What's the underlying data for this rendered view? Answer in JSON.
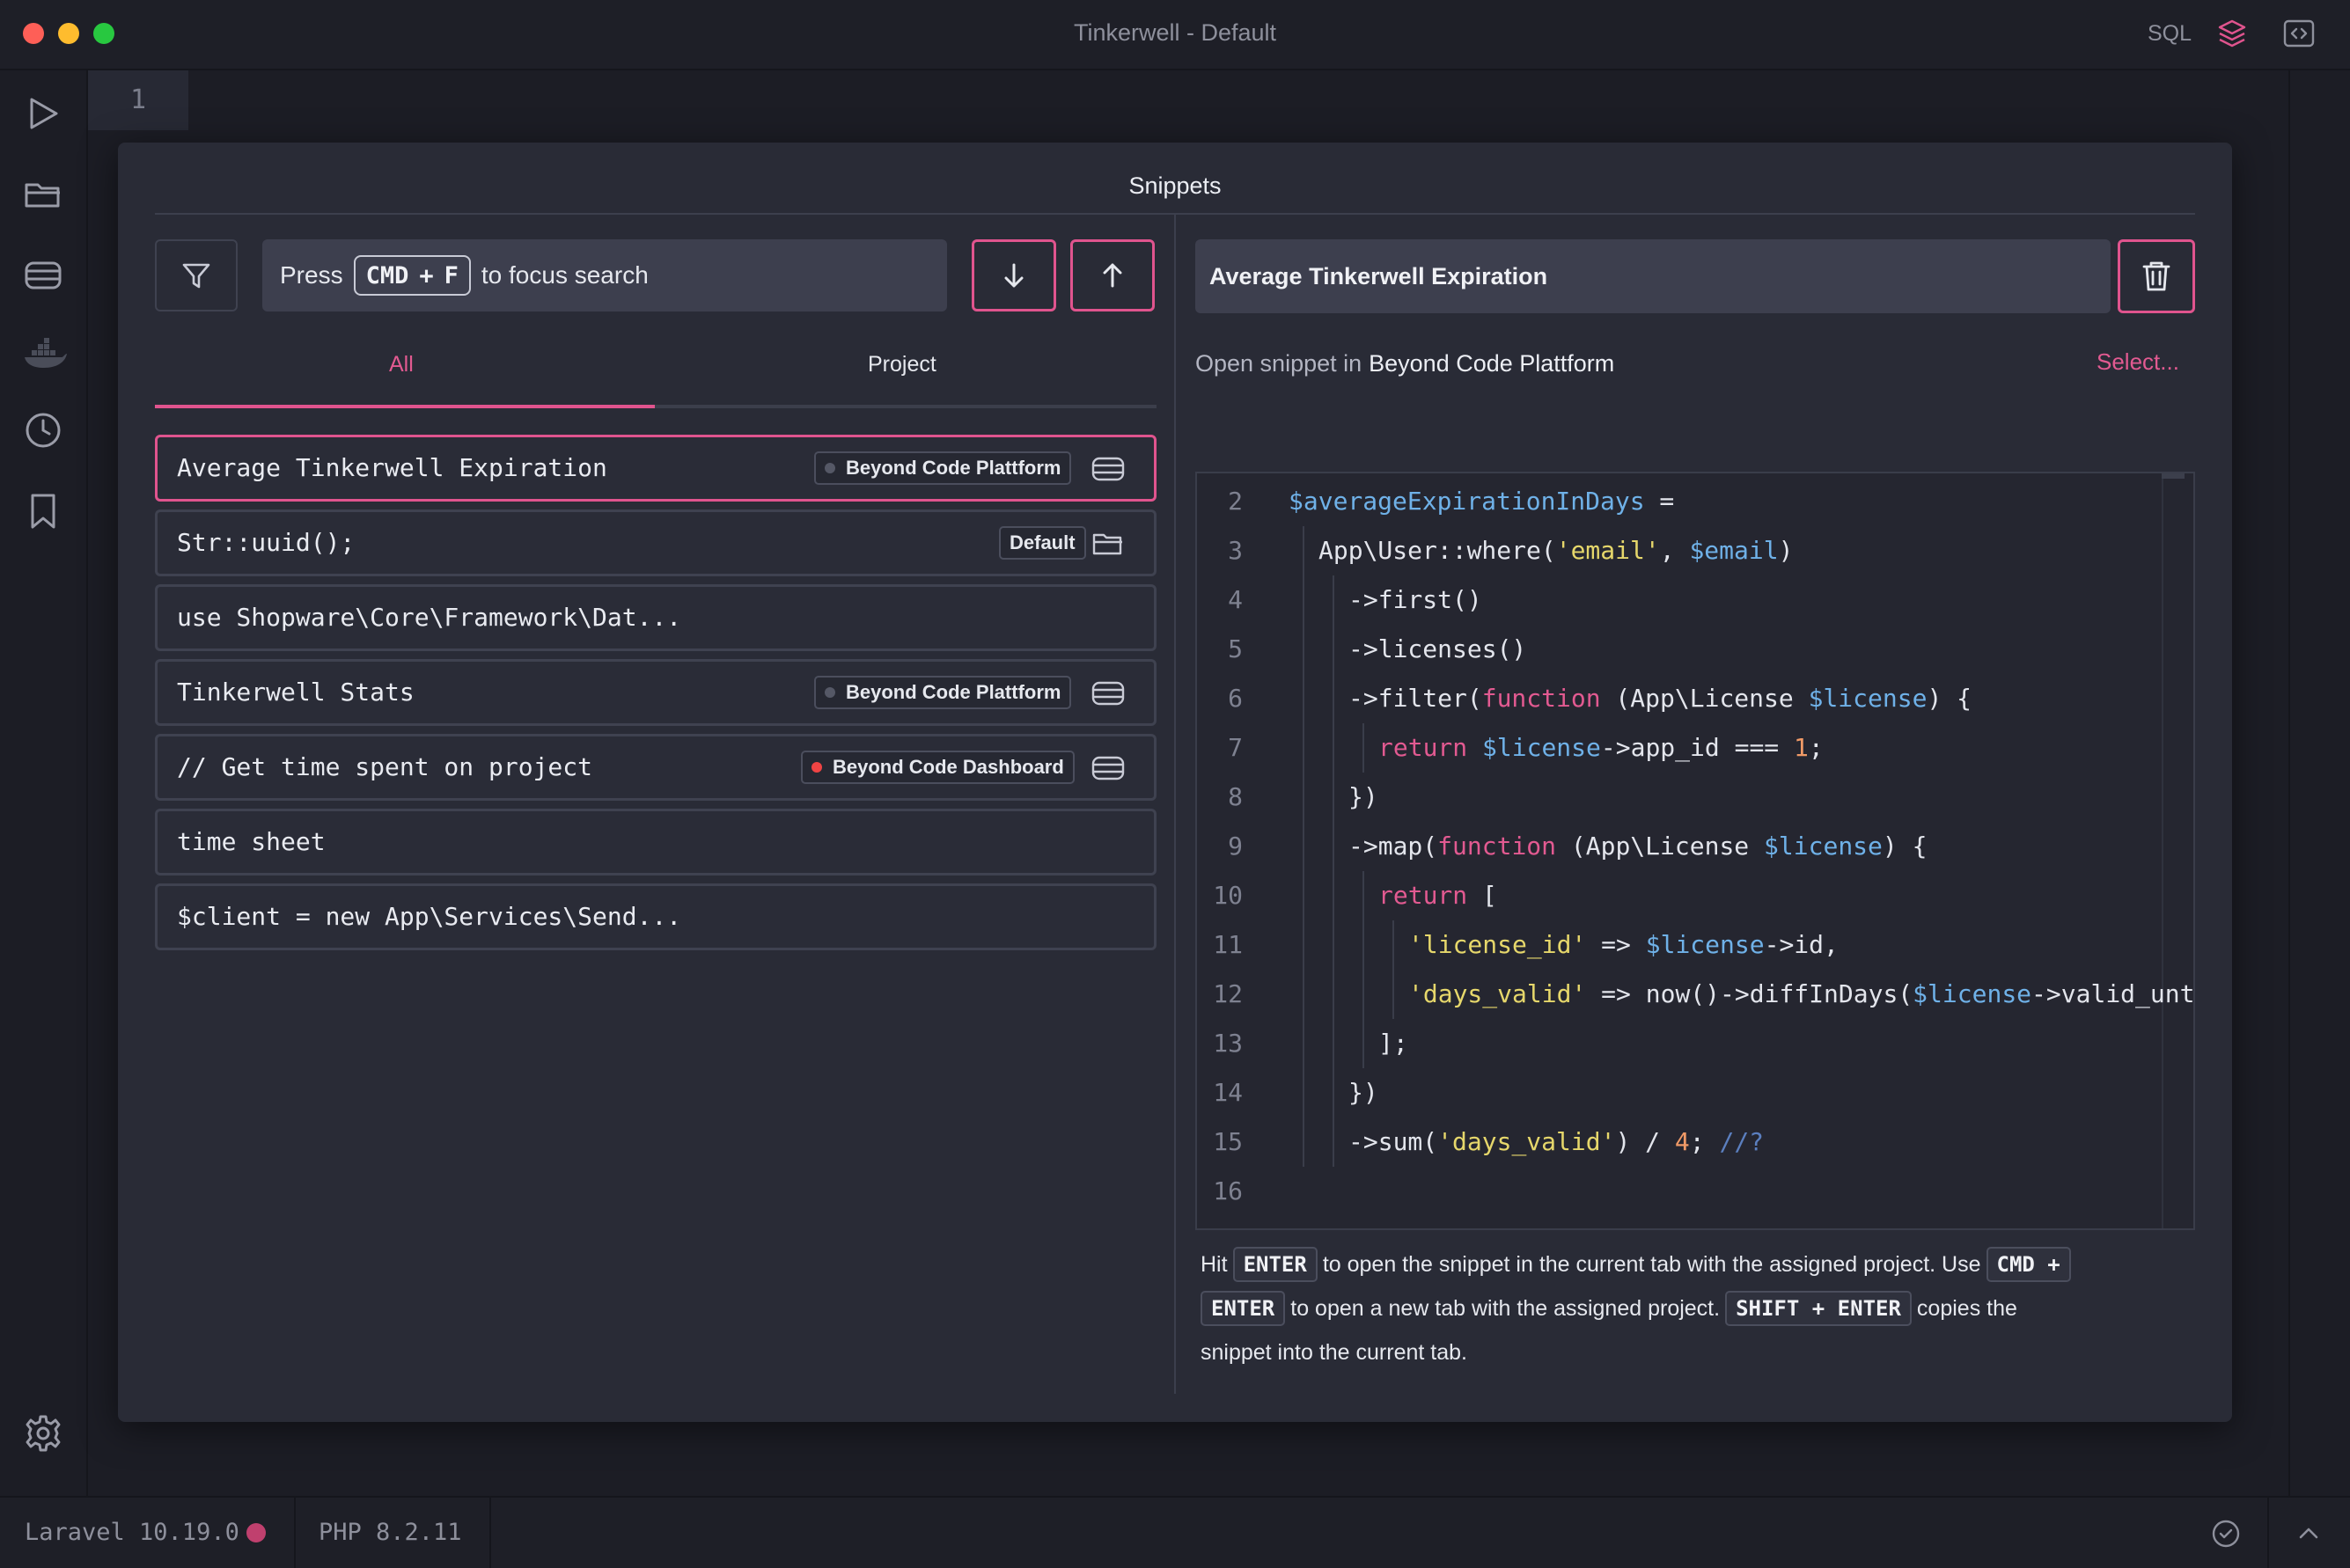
{
  "window": {
    "title": "Tinkerwell - Default",
    "sql_label": "SQL"
  },
  "sidebar": {
    "items": [
      {
        "name": "run",
        "icon": "play-icon"
      },
      {
        "name": "open",
        "icon": "folder-icon"
      },
      {
        "name": "servers",
        "icon": "server-icon"
      },
      {
        "name": "docker",
        "icon": "docker-icon"
      },
      {
        "name": "history",
        "icon": "clock-icon"
      },
      {
        "name": "snippets",
        "icon": "bookmark-icon"
      }
    ],
    "settings_icon": "gear-icon"
  },
  "editor": {
    "line_number": "1"
  },
  "modal": {
    "title": "Snippets",
    "search": {
      "press": "Press",
      "key1": "CMD",
      "plus": "+",
      "key2": "F",
      "suffix": "to focus search"
    },
    "tabs": [
      {
        "label": "All",
        "active": true
      },
      {
        "label": "Project",
        "active": false
      }
    ],
    "snippets": [
      {
        "text": "Average Tinkerwell Expiration",
        "badge": "Beyond Code Plattform",
        "dot": "#555866",
        "icon": "server-icon",
        "selected": true
      },
      {
        "text": "Str::uuid();",
        "badge": "Default",
        "dot": "",
        "icon": "folder-icon",
        "selected": false
      },
      {
        "text": "use Shopware\\Core\\Framework\\Dat...",
        "badge": "",
        "dot": "",
        "icon": "",
        "selected": false
      },
      {
        "text": "Tinkerwell Stats",
        "badge": "Beyond Code Plattform",
        "dot": "#555866",
        "icon": "server-icon",
        "selected": false
      },
      {
        "text": "// Get time spent on project",
        "badge": "Beyond Code Dashboard",
        "dot": "#ef4444",
        "icon": "server-icon",
        "selected": false
      },
      {
        "text": "time sheet",
        "badge": "",
        "dot": "",
        "icon": "",
        "selected": false
      },
      {
        "text": "$client = new App\\Services\\Send...",
        "badge": "",
        "dot": "",
        "icon": "",
        "selected": false
      }
    ],
    "detail": {
      "title": "Average Tinkerwell Expiration",
      "open_in_label": "Open snippet in",
      "open_in_project": "Beyond Code Plattform",
      "select_label": "Select..."
    },
    "code": [
      {
        "n": "2",
        "indent": 0,
        "tokens": [
          [
            "var",
            "$averageExpirationInDays"
          ],
          [
            "plain",
            " ="
          ]
        ]
      },
      {
        "n": "3",
        "indent": 1,
        "tokens": [
          [
            "plain",
            "App\\User::where("
          ],
          [
            "str",
            "'email'"
          ],
          [
            "plain",
            ", "
          ],
          [
            "var",
            "$email"
          ],
          [
            "plain",
            ")"
          ]
        ]
      },
      {
        "n": "4",
        "indent": 2,
        "tokens": [
          [
            "plain",
            "->first()"
          ]
        ]
      },
      {
        "n": "5",
        "indent": 2,
        "tokens": [
          [
            "plain",
            "->licenses()"
          ]
        ]
      },
      {
        "n": "6",
        "indent": 2,
        "tokens": [
          [
            "plain",
            "->filter("
          ],
          [
            "kw",
            "function"
          ],
          [
            "plain",
            " (App\\License "
          ],
          [
            "var",
            "$license"
          ],
          [
            "plain",
            ") {"
          ]
        ]
      },
      {
        "n": "7",
        "indent": 3,
        "tokens": [
          [
            "kw",
            "return"
          ],
          [
            "plain",
            " "
          ],
          [
            "var",
            "$license"
          ],
          [
            "plain",
            "->app_id === "
          ],
          [
            "num",
            "1"
          ],
          [
            "plain",
            ";"
          ]
        ]
      },
      {
        "n": "8",
        "indent": 2,
        "tokens": [
          [
            "plain",
            "})"
          ]
        ]
      },
      {
        "n": "9",
        "indent": 2,
        "tokens": [
          [
            "plain",
            "->map("
          ],
          [
            "kw",
            "function"
          ],
          [
            "plain",
            " (App\\License "
          ],
          [
            "var",
            "$license"
          ],
          [
            "plain",
            ") {"
          ]
        ]
      },
      {
        "n": "10",
        "indent": 3,
        "tokens": [
          [
            "kw",
            "return"
          ],
          [
            "plain",
            " ["
          ]
        ]
      },
      {
        "n": "11",
        "indent": 4,
        "tokens": [
          [
            "str",
            "'license_id'"
          ],
          [
            "plain",
            " => "
          ],
          [
            "var",
            "$license"
          ],
          [
            "plain",
            "->id,"
          ]
        ]
      },
      {
        "n": "12",
        "indent": 4,
        "tokens": [
          [
            "str",
            "'days_valid'"
          ],
          [
            "plain",
            " => now()->diffInDays("
          ],
          [
            "var",
            "$license"
          ],
          [
            "plain",
            "->valid_unt"
          ]
        ]
      },
      {
        "n": "13",
        "indent": 3,
        "tokens": [
          [
            "plain",
            "];"
          ]
        ]
      },
      {
        "n": "14",
        "indent": 2,
        "tokens": [
          [
            "plain",
            "})"
          ]
        ]
      },
      {
        "n": "15",
        "indent": 2,
        "tokens": [
          [
            "plain",
            "->sum("
          ],
          [
            "str",
            "'days_valid'"
          ],
          [
            "plain",
            ") / "
          ],
          [
            "num",
            "4"
          ],
          [
            "plain",
            "; "
          ],
          [
            "cmt",
            "//?"
          ]
        ]
      },
      {
        "n": "16",
        "indent": 0,
        "tokens": []
      }
    ],
    "help": {
      "hit": "Hit",
      "enter": "ENTER",
      "part1": "to open the snippet in the current tab with the assigned project. Use",
      "cmd_plus": "CMD +",
      "enter2": "ENTER",
      "part2": "to open a new tab with the assigned project.",
      "shift_enter": "SHIFT + ENTER",
      "part3": "copies the",
      "part4": "snippet into the current tab."
    }
  },
  "statusbar": {
    "laravel": "Laravel 10.19.0",
    "php": "PHP 8.2.11"
  },
  "colors": {
    "accent": "#e0548e",
    "background": "#1c1d25",
    "modal": "#292b36"
  }
}
